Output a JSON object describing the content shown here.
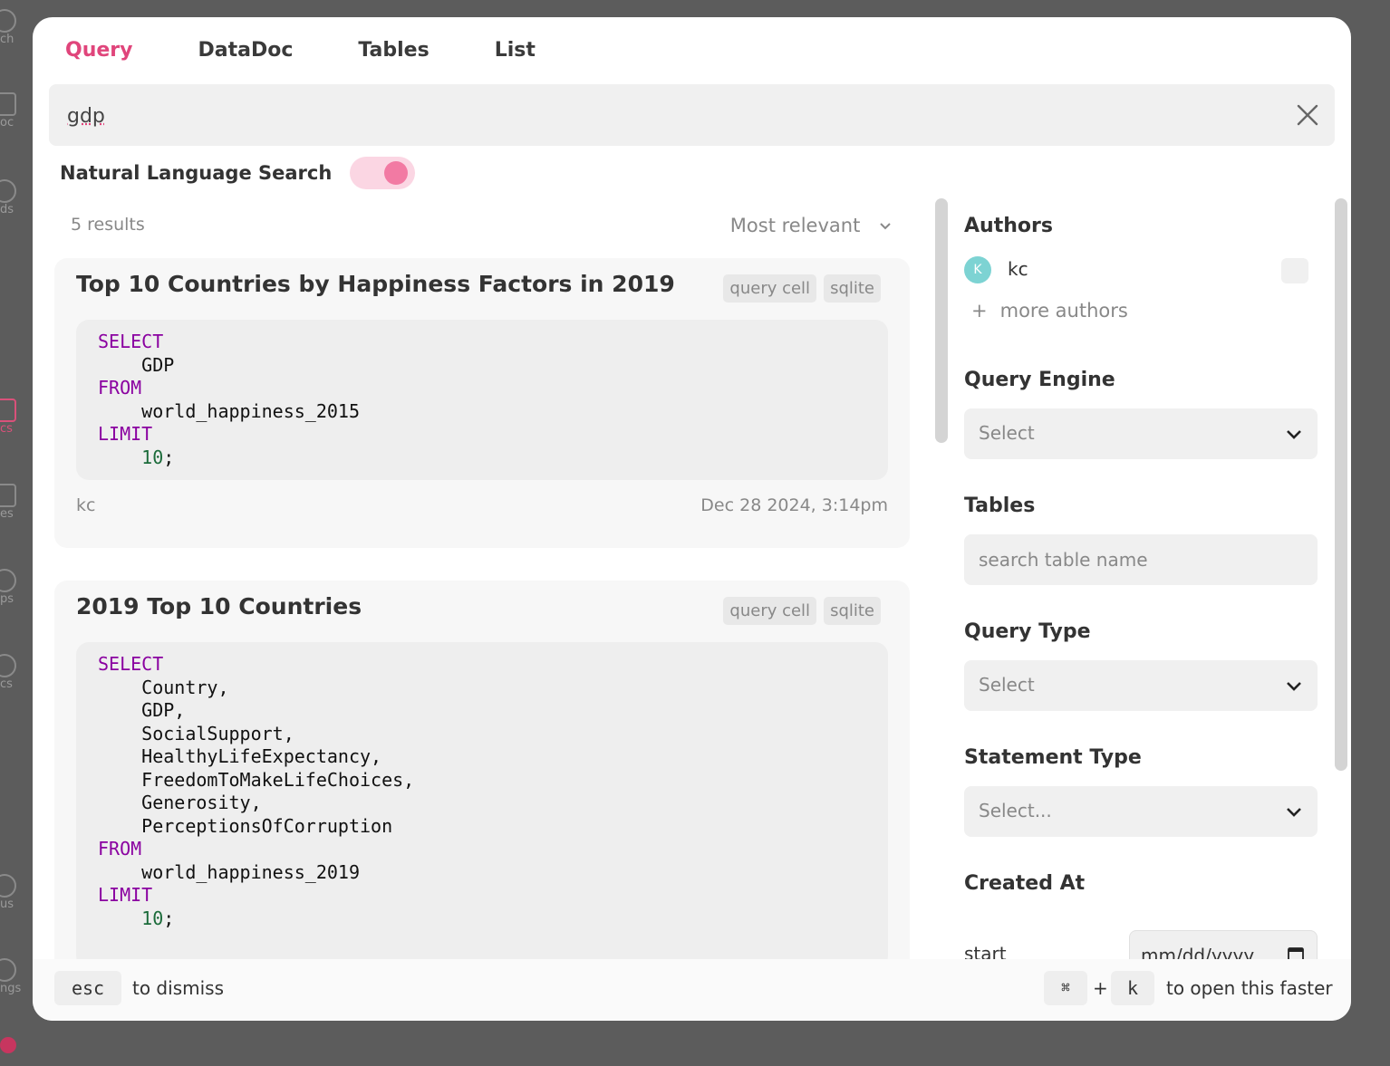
{
  "background_sidebar": {
    "fragments": [
      "ch",
      "oc",
      "ds",
      "cs",
      "es",
      "ps",
      "cs",
      "us",
      "ngs"
    ]
  },
  "tabs": [
    {
      "label": "Query",
      "active": true
    },
    {
      "label": "DataDoc",
      "active": false
    },
    {
      "label": "Tables",
      "active": false
    },
    {
      "label": "List",
      "active": false
    }
  ],
  "search": {
    "value": "gdp",
    "clear_icon": "close-icon"
  },
  "nl_search": {
    "label": "Natural Language Search",
    "enabled": true
  },
  "results": {
    "count_label": "5 results",
    "sort_label": "Most relevant",
    "items": [
      {
        "title": "Top 10 Countries by Happiness Factors in 2019",
        "tags": [
          "query cell",
          "sqlite"
        ],
        "author": "kc",
        "date": "Dec 28 2024, 3:14pm"
      },
      {
        "title": "2019 Top 10 Countries",
        "tags": [
          "query cell",
          "sqlite"
        ]
      }
    ]
  },
  "filters": {
    "authors_title": "Authors",
    "author": {
      "initial": "K",
      "name": "kc"
    },
    "more_authors": "more authors",
    "query_engine_title": "Query Engine",
    "query_engine_value": "Select",
    "tables_title": "Tables",
    "tables_placeholder": "search table name",
    "query_type_title": "Query Type",
    "query_type_value": "Select",
    "statement_type_title": "Statement Type",
    "statement_type_value": "Select...",
    "created_at_title": "Created At",
    "start_label": "start",
    "start_placeholder": "mm/dd/yyyy"
  },
  "footer": {
    "esc_key": "esc",
    "dismiss_text": "to dismiss",
    "cmd_key": "⌘",
    "plus": "+",
    "k_key": "k",
    "open_text": "to open this faster"
  },
  "colors": {
    "accent": "#e0457b",
    "toggle_track": "#fbd6e3",
    "toggle_knob": "#f27aa3",
    "keyword": "#8a00a0",
    "number": "#1b6b3a"
  }
}
